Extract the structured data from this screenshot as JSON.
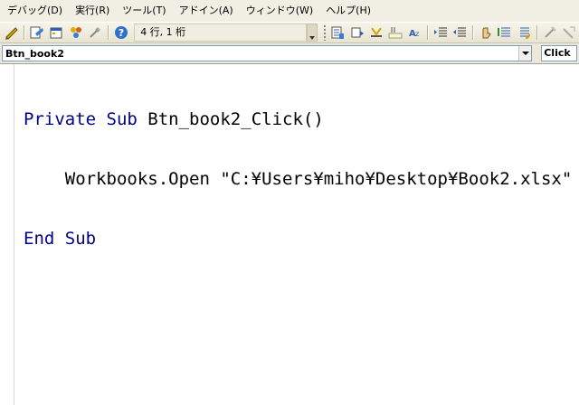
{
  "menubar": {
    "items": [
      {
        "label": "デバッグ(D)"
      },
      {
        "label": "実行(R)"
      },
      {
        "label": "ツール(T)"
      },
      {
        "label": "アドイン(A)"
      },
      {
        "label": "ウィンドウ(W)"
      },
      {
        "label": "ヘルプ(H)"
      }
    ]
  },
  "toolbar": {
    "position_readout": "4 行, 1 桁",
    "icons": [
      "design-mode-icon",
      "project-explorer-icon",
      "properties-window-icon",
      "object-browser-icon",
      "toolbox-icon",
      "help-icon",
      "indent-icon",
      "outdent-icon",
      "toggle-breakpoint-icon",
      "comment-block-icon",
      "uncomment-block-icon",
      "quick-info-icon",
      "parameter-info-icon",
      "complete-word-icon",
      "list-properties-icon",
      "toggle-bookmark-icon",
      "next-bookmark-icon",
      "previous-bookmark-icon",
      "clear-bookmarks-icon"
    ]
  },
  "object_combo": {
    "value": "Btn_book2"
  },
  "procedure_combo": {
    "value": "Click"
  },
  "code": {
    "line1": {
      "kw1": "Private",
      "kw2": "Sub",
      "rest": " Btn_book2_Click()"
    },
    "line2": {
      "text": "    Workbooks.Open \"C:¥Users¥miho¥Desktop¥Book2.xlsx\""
    },
    "line3": {
      "kw1": "End",
      "kw2": "Sub"
    }
  },
  "colors": {
    "keyword": "#00008b",
    "menubar_bg": "#f1efe3"
  }
}
